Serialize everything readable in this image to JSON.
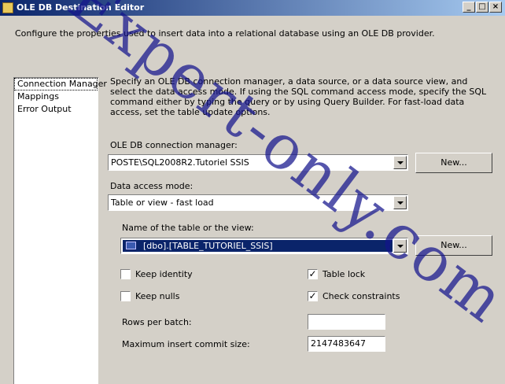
{
  "window": {
    "title": "OLE DB Destination Editor",
    "controls": [
      "_",
      "□",
      "×"
    ]
  },
  "description": "Configure the properties used to insert data into a relational database using an OLE DB provider.",
  "nav": {
    "items": [
      "Connection Manager",
      "Mappings",
      "Error Output"
    ],
    "selected": "Connection Manager"
  },
  "intro": "Specify an OLE DB connection manager, a data source, or a data source view, and select the data access mode. If using the SQL command access mode, specify the SQL command either by typing the query or by using Query Builder. For fast-load data access, set the table update options.",
  "connection": {
    "label": "OLE DB connection manager:",
    "value": "POSTE\\SQL2008R2.Tutoriel SSIS",
    "new_label": "New..."
  },
  "access_mode": {
    "label": "Data access mode:",
    "value": "Table or view - fast load"
  },
  "table": {
    "label": "Name of the table or the view:",
    "value": "[dbo].[TABLE_TUTORIEL_SSIS]",
    "new_label": "New..."
  },
  "options": {
    "keep_identity": {
      "label": "Keep identity",
      "checked": false
    },
    "table_lock": {
      "label": "Table lock",
      "checked": true
    },
    "keep_nulls": {
      "label": "Keep nulls",
      "checked": false
    },
    "check_constraints": {
      "label": "Check constraints",
      "checked": true
    }
  },
  "rows_per_batch": {
    "label": "Rows per batch:",
    "value": ""
  },
  "max_commit": {
    "label": "Maximum insert commit size:",
    "value": "2147483647"
  },
  "watermark": "Expert-only.com"
}
